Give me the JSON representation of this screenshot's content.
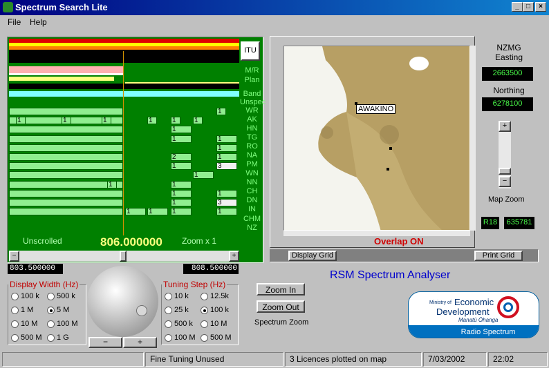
{
  "window": {
    "title": "Spectrum Search Lite"
  },
  "menu": [
    "File",
    "Help"
  ],
  "spectrum": {
    "itu_button": "ITU",
    "row_labels": [
      "M/R",
      "Plan",
      "Band",
      "Unspec",
      "WR",
      "AK",
      "HN",
      "TG",
      "RO",
      "NA",
      "PM",
      "WN",
      "NN",
      "CH",
      "DN",
      "IN",
      "CHM",
      "NZ"
    ],
    "unscrolled_label": "Unscrolled",
    "center_freq": "806.000000",
    "zoom_label": "Zoom x 1",
    "low_freq": "803.500000",
    "high_freq": "808.500000",
    "rows": [
      {
        "label": "WR",
        "cells": [
          {
            "t": "1"
          }
        ]
      },
      {
        "label": "AK",
        "cells": [
          {
            "t": "1"
          },
          {
            "t": "1"
          },
          {
            "t": "1"
          },
          {
            "t": "1"
          },
          {
            "t": "1"
          },
          {
            "t": "1"
          }
        ]
      },
      {
        "label": "HN",
        "cells": [
          {
            "t": "1"
          }
        ]
      },
      {
        "label": "TG",
        "cells": [
          {
            "t": "1"
          },
          {
            "t": "1"
          }
        ]
      },
      {
        "label": "RO",
        "cells": [
          {
            "t": "1"
          }
        ]
      },
      {
        "label": "NA",
        "cells": [
          {
            "t": "2"
          },
          {
            "t": "1"
          }
        ]
      },
      {
        "label": "PM",
        "cells": [
          {
            "t": "1"
          },
          {
            "t": "3"
          }
        ]
      },
      {
        "label": "WN",
        "cells": [
          {
            "t": "1"
          }
        ]
      },
      {
        "label": "NN",
        "cells": [
          {
            "t": "1"
          },
          {
            "t": "1"
          }
        ]
      },
      {
        "label": "CH",
        "cells": [
          {
            "t": "1"
          },
          {
            "t": "1"
          }
        ]
      },
      {
        "label": "DN",
        "cells": [
          {
            "t": "1"
          },
          {
            "t": "3"
          }
        ]
      },
      {
        "label": "IN",
        "cells": [
          {
            "t": "1"
          },
          {
            "t": "1"
          },
          {
            "t": "1"
          },
          {
            "t": "1"
          }
        ]
      }
    ]
  },
  "display_width": {
    "legend": "Display Width (Hz)",
    "options": [
      "100 k",
      "500 k",
      "1 M",
      "5 M",
      "10 M",
      "100 M",
      "500 M",
      "1 G"
    ],
    "selected": "5 M"
  },
  "tuning_step": {
    "legend": "Tuning Step (Hz)",
    "options": [
      "10 k",
      "12.5k",
      "25 k",
      "100 k",
      "500 k",
      "10 M",
      "100 M",
      "500 M"
    ],
    "selected": "100 k"
  },
  "knob": {
    "minus": "−",
    "plus": "+"
  },
  "zoom": {
    "in": "Zoom In",
    "out": "Zoom Out",
    "label": "Spectrum Zoom"
  },
  "map": {
    "place_label": "AWAKINO",
    "overlap_text": "Overlap ON",
    "display_grid": "Display Grid",
    "print_grid": "Print Grid"
  },
  "coords": {
    "header": "NZMG Easting",
    "easting": "2663500",
    "northing_label": "Northing",
    "northing": "6278100",
    "map_zoom_label": "Map Zoom",
    "grid_ref": "R18",
    "grid_val": "635781"
  },
  "analyser_title": "RSM Spectrum Analyser",
  "logo": {
    "ministry": "Ministry of",
    "line1": "Economic",
    "line2": "Development",
    "maori": "Manatū Ōhanga",
    "band": "Radio Spectrum"
  },
  "status": {
    "s1": "",
    "s2": "Fine Tuning Unused",
    "s3": "3 Licences plotted on map",
    "date": "7/03/2002",
    "time": "22:02"
  },
  "colors": {
    "spectrum_bg": "#008000",
    "cell": "#90ee90",
    "accent_red": "#d00000",
    "title_blue": "#0000cc"
  }
}
